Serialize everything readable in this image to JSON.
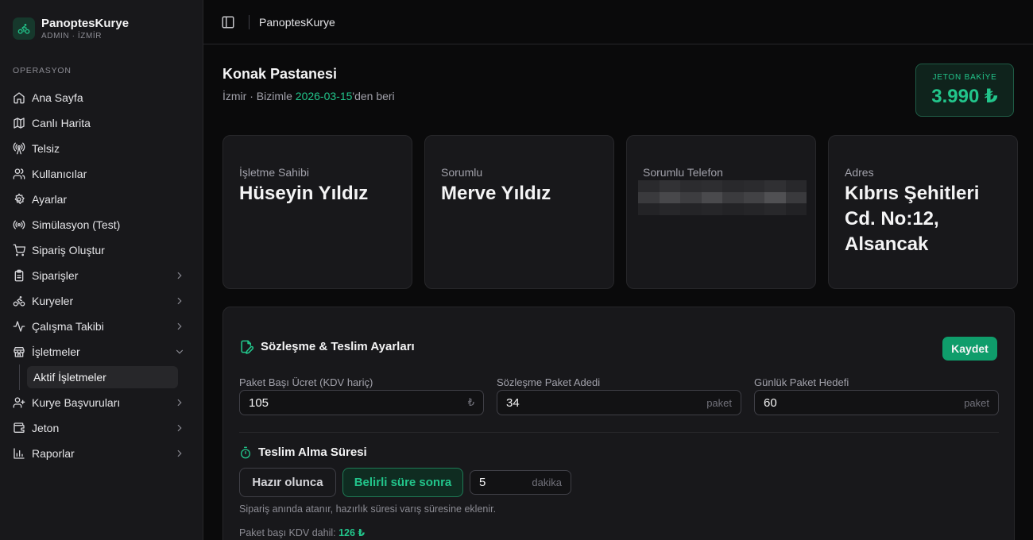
{
  "brand": {
    "name": "PanoptesKurye",
    "sub": "ADMIN · İZMİR"
  },
  "sidebar": {
    "section": "OPERASYON",
    "items": [
      {
        "label": "Ana Sayfa",
        "icon": "home-icon"
      },
      {
        "label": "Canlı Harita",
        "icon": "map-icon"
      },
      {
        "label": "Telsiz",
        "icon": "radio-tower-icon"
      },
      {
        "label": "Kullanıcılar",
        "icon": "users-icon"
      },
      {
        "label": "Ayarlar",
        "icon": "gear-icon"
      },
      {
        "label": "Simülasyon (Test)",
        "icon": "broadcast-icon"
      },
      {
        "label": "Sipariş Oluştur",
        "icon": "cart-icon"
      },
      {
        "label": "Siparişler",
        "icon": "clipboard-icon",
        "expandable": true
      },
      {
        "label": "Kuryeler",
        "icon": "bike-icon",
        "expandable": true
      },
      {
        "label": "Çalışma Takibi",
        "icon": "activity-icon",
        "expandable": true
      },
      {
        "label": "İşletmeler",
        "icon": "store-icon",
        "expanded": true
      },
      {
        "label": "Kurye Başvuruları",
        "icon": "user-plus-icon",
        "expandable": true
      },
      {
        "label": "Jeton",
        "icon": "wallet-icon",
        "expandable": true
      },
      {
        "label": "Raporlar",
        "icon": "bar-chart-icon",
        "expandable": true
      }
    ],
    "sub_active": "Aktif İşletmeler"
  },
  "topbar": {
    "title": "PanoptesKurye"
  },
  "business": {
    "name": "Konak Pastanesi",
    "meta_prefix": "İzmir · Bizimle ",
    "since": "2026-03-15",
    "meta_suffix": "'den beri"
  },
  "jeton": {
    "label": "JETON BAKİYE",
    "value": "3.990 ₺"
  },
  "cards": {
    "owner": {
      "label": "İşletme Sahibi",
      "value": "Hüseyin Yıldız"
    },
    "responsible": {
      "label": "Sorumlu",
      "value": "Merve Yıldız"
    },
    "phone": {
      "label": "Sorumlu Telefon"
    },
    "address": {
      "label": "Adres",
      "value": "Kıbrıs Şehitleri Cd. No:12, Alsancak"
    }
  },
  "contract": {
    "title": "Sözleşme & Teslim Ayarları",
    "save": "Kaydet",
    "fields": [
      {
        "label": "Paket Başı Ücret (KDV hariç)",
        "value": "105",
        "suffix": "₺"
      },
      {
        "label": "Sözleşme Paket Adedi",
        "value": "34",
        "suffix": "paket"
      },
      {
        "label": "Günlük Paket Hedefi",
        "value": "60",
        "suffix": "paket"
      }
    ]
  },
  "pickup": {
    "title": "Teslim Alma Süresi",
    "option_ready": "Hazır olunca",
    "option_timed": "Belirli süre sonra",
    "minutes": "5",
    "minutes_suffix": "dakika",
    "hint": "Sipariş anında atanır, hazırlık süresi varış süresine eklenir.",
    "kdv_label": "Paket başı KDV dahil: ",
    "kdv_value": "126 ₺"
  },
  "colors": {
    "accent": "#22c58b",
    "button": "#0f9d6b",
    "bg": "#0a0a0b",
    "card": "#18181b"
  }
}
